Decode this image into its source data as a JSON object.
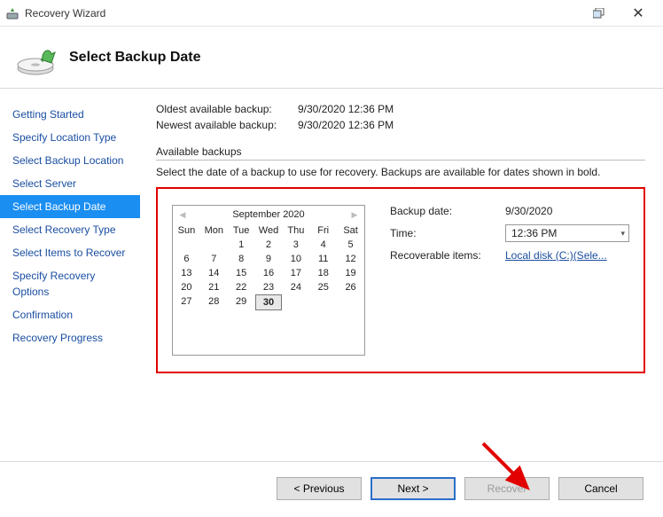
{
  "window": {
    "title": "Recovery Wizard"
  },
  "header": {
    "title": "Select Backup Date"
  },
  "sidebar": {
    "items": [
      {
        "label": "Getting Started"
      },
      {
        "label": "Specify Location Type"
      },
      {
        "label": "Select Backup Location"
      },
      {
        "label": "Select Server"
      },
      {
        "label": "Select Backup Date"
      },
      {
        "label": "Select Recovery Type"
      },
      {
        "label": "Select Items to Recover"
      },
      {
        "label": "Specify Recovery Options"
      },
      {
        "label": "Confirmation"
      },
      {
        "label": "Recovery Progress"
      }
    ],
    "activeIndex": 4
  },
  "info": {
    "oldestLabel": "Oldest available backup:",
    "oldestVal": "9/30/2020 12:36 PM",
    "newestLabel": "Newest available backup:",
    "newestVal": "9/30/2020 12:36 PM"
  },
  "fieldset": {
    "title": "Available backups",
    "instruction": "Select the date of a backup to use for recovery. Backups are available for dates shown in bold."
  },
  "calendar": {
    "title": "September 2020",
    "dayHeaders": [
      "Sun",
      "Mon",
      "Tue",
      "Wed",
      "Thu",
      "Fri",
      "Sat"
    ],
    "weeks": [
      [
        "",
        "",
        "1",
        "2",
        "3",
        "4",
        "5"
      ],
      [
        "6",
        "7",
        "8",
        "9",
        "10",
        "11",
        "12"
      ],
      [
        "13",
        "14",
        "15",
        "16",
        "17",
        "18",
        "19"
      ],
      [
        "20",
        "21",
        "22",
        "23",
        "24",
        "25",
        "26"
      ],
      [
        "27",
        "28",
        "29",
        "30",
        "",
        "",
        ""
      ]
    ],
    "selected": "30"
  },
  "details": {
    "backupDateLabel": "Backup date:",
    "backupDateVal": "9/30/2020",
    "timeLabel": "Time:",
    "timeVal": "12:36 PM",
    "recoverableLabel": "Recoverable items:",
    "recoverableVal": "Local disk (C:)(Sele..."
  },
  "buttons": {
    "previous": "< Previous",
    "next": "Next >",
    "recover": "Recover",
    "cancel": "Cancel"
  }
}
